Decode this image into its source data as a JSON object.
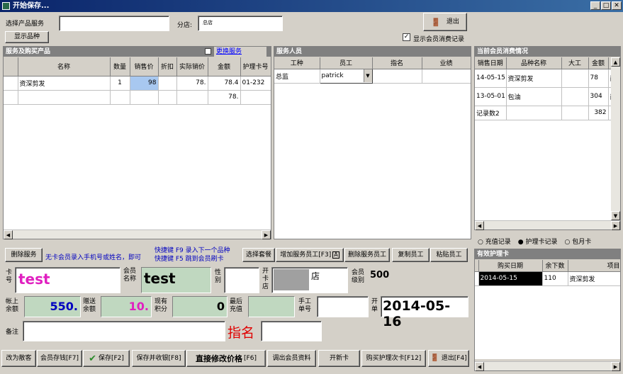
{
  "window": {
    "title": "开始保存..."
  },
  "top": {
    "product_label": "选择产品服务",
    "product_value": "",
    "store_label": "分店:",
    "store_value": "总店",
    "show_items_label": "显示品种",
    "exit_label": "退出",
    "show_records_label": "显示会员消费记录",
    "show_records_checked": true
  },
  "services_panel": {
    "title": "服务及购买产品",
    "change_label": "更换服务",
    "columns": [
      "名称",
      "数量",
      "销售价",
      "折扣",
      "实际销价",
      "金额",
      "护理卡号"
    ],
    "rows": [
      [
        "资深剪发",
        "1",
        "98",
        "",
        "78.",
        "78.4",
        "01-232"
      ],
      [
        "",
        "",
        "",
        "",
        "",
        "78.",
        ""
      ]
    ]
  },
  "staff_panel": {
    "title": "服务人员",
    "columns": [
      "工种",
      "员工",
      "指名",
      "业绩"
    ],
    "rows": [
      [
        "总监",
        "patrick",
        "",
        ""
      ]
    ]
  },
  "history_panel": {
    "title": "当前会员消费情况",
    "columns": [
      "销售日期",
      "品种名称",
      "大工",
      "金额"
    ],
    "rows": [
      [
        "14-05-15",
        "资深剪发",
        "",
        "78",
        "西"
      ],
      [
        "13-05-01",
        "包油",
        "",
        "304",
        "西"
      ],
      [
        "记录数2",
        "",
        "",
        "382",
        ""
      ]
    ]
  },
  "radios": [
    "充值记录",
    "护理卡记录",
    "包月卡"
  ],
  "radio_selected": 1,
  "cards_panel": {
    "title": "有效护理卡",
    "columns": [
      "购买日期",
      "余下数",
      "项目"
    ],
    "rows": [
      [
        "2014-05-15",
        "110",
        "资深剪发"
      ]
    ]
  },
  "actions": {
    "delete_service": "删除服务",
    "hint1": "无卡会员录入手机号或姓名，即可",
    "hint2a": "快捷键 F9 录入下一个品种",
    "hint2b": "快捷键 F5 跳到会员刷卡",
    "select_package": "选择套餐",
    "add_staff": "增加服务员工[F3]",
    "add_staff_key": "A",
    "delete_staff": "删除服务员工",
    "copy_staff": "复制员工",
    "paste_staff": "粘贴员工"
  },
  "member": {
    "card_label": "卡号",
    "card_value": "test",
    "name_label": "会员名称",
    "name_value": "test",
    "gender_label": "性别",
    "gender_value": "",
    "store_label": "开卡店",
    "store_value": "店",
    "level_label": "会员级别",
    "level_value": "500",
    "balance_label": "帐上余额",
    "balance_value": "550.",
    "gift_label": "赠送余额",
    "gift_value": "10.",
    "points_label": "现有积分",
    "points_value": "0",
    "last_recharge_label": "最后充值",
    "last_recharge_value": "",
    "manual_label": "手工单号",
    "manual_value": "",
    "open_label": "开单",
    "open_value": "2014-05-16",
    "note_label": "备注",
    "note_value": "",
    "named_label": "指名",
    "named_value": ""
  },
  "bottom": {
    "b1": "改为散客",
    "b2": "会员存钱[F7]",
    "b3": "保存[F2]",
    "b4": "保存并收银[F8]",
    "b5": "直接修改价格",
    "b5k": "[F6]",
    "b6": "调出会员资料",
    "b7": "开新卡",
    "b8": "购买护理次卡[F12]",
    "b9": "退出[F4]"
  },
  "colors": {
    "accent": "#0a246a",
    "member_text": "#e020c0",
    "balance": "#0000c0",
    "green_field": "#c0d8c0",
    "named": "#e00000"
  }
}
